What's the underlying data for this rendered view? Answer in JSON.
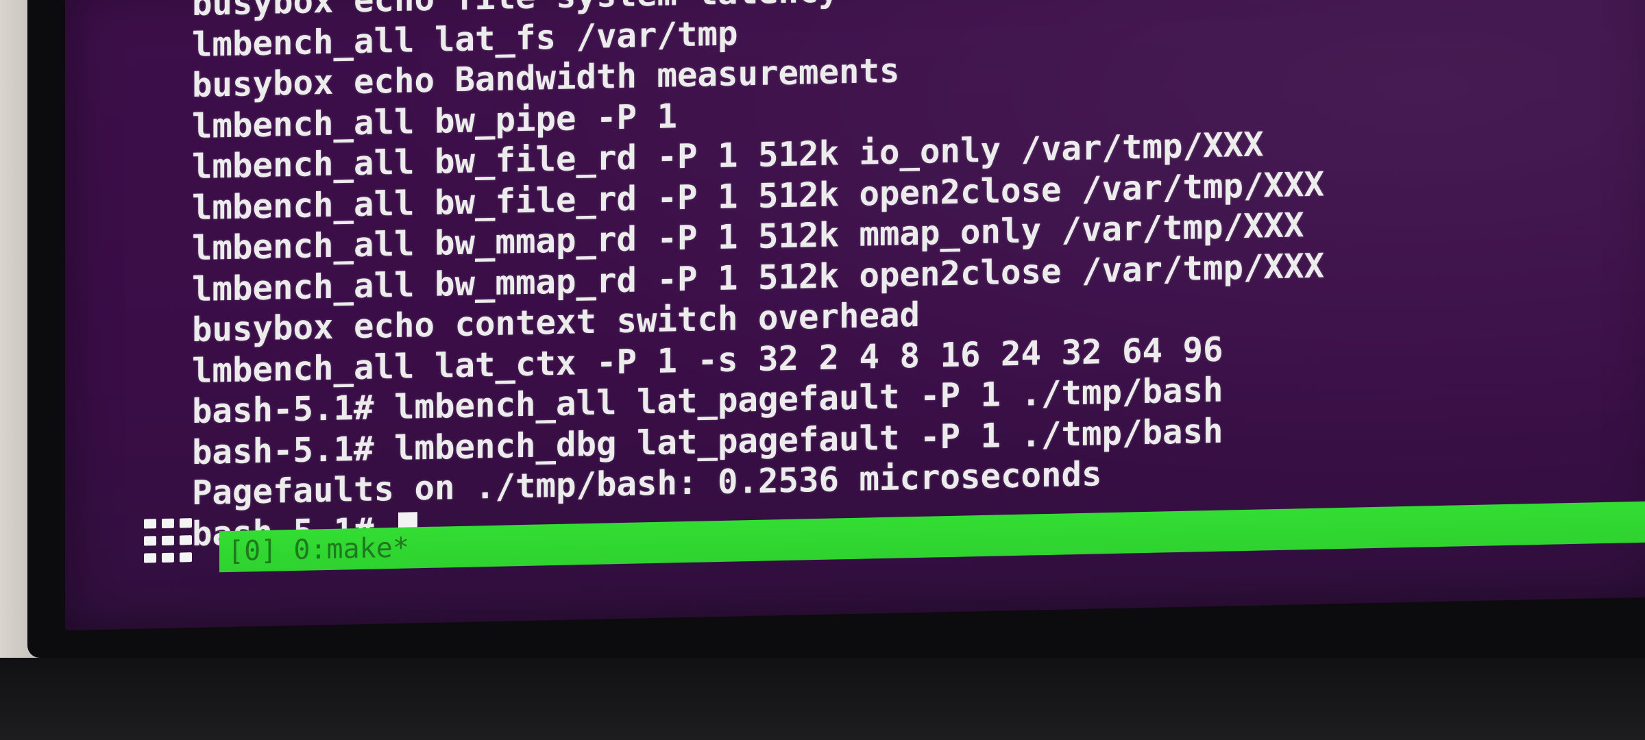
{
  "terminal": {
    "lines": [
      "busybox echo file system latency",
      "lmbench_all lat_fs /var/tmp",
      "busybox echo Bandwidth measurements",
      "lmbench_all bw_pipe -P 1",
      "lmbench_all bw_file_rd -P 1 512k io_only /var/tmp/XXX",
      "lmbench_all bw_file_rd -P 1 512k open2close /var/tmp/XXX",
      "lmbench_all bw_mmap_rd -P 1 512k mmap_only /var/tmp/XXX",
      "lmbench_all bw_mmap_rd -P 1 512k open2close /var/tmp/XXX",
      "busybox echo context switch overhead",
      "lmbench_all lat_ctx -P 1 -s 32 2 4 8 16 24 32 64 96",
      "bash-5.1# lmbench_all lat_pagefault -P 1 ./tmp/bash",
      "bash-5.1# lmbench_dbg lat_pagefault -P 1 ./tmp/bash",
      "Pagefaults on ./tmp/bash: 0.2536 microseconds"
    ],
    "prompt": "bash-5.1#"
  },
  "statusbar": {
    "text": "[0] 0:make*"
  },
  "colors": {
    "background": "#3a0d47",
    "text": "#ececec",
    "statusbar": "#33dd33",
    "statusbar_text": "#1f7a1f"
  },
  "icons": {
    "app_launcher": "grid-icon"
  }
}
